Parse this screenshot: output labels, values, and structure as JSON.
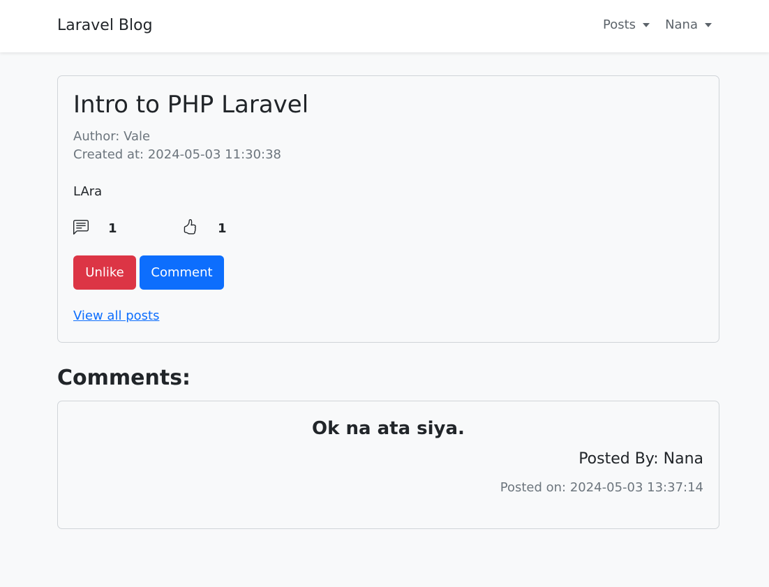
{
  "navbar": {
    "brand": "Laravel Blog",
    "menu": [
      {
        "label": "Posts"
      },
      {
        "label": "Nana"
      }
    ]
  },
  "post": {
    "title": "Intro to PHP Laravel",
    "author": "Author: Vale",
    "created_at": "Created at: 2024-05-03 11:30:38",
    "body": "LAra",
    "comment_count": "1",
    "like_count": "1",
    "unlike_label": "Unlike",
    "comment_label": "Comment",
    "view_all_label": "View all posts"
  },
  "comments": {
    "heading": "Comments:",
    "items": [
      {
        "text": "Ok na ata siya.",
        "posted_by": "Posted By: Nana",
        "posted_on": "Posted on: 2024-05-03 13:37:14"
      }
    ]
  },
  "icons": {
    "comment": "chat-left-text-icon",
    "like": "hand-thumbs-up-icon"
  },
  "colors": {
    "danger": "#dc3545",
    "primary": "#0d6efd",
    "background": "#f8f9fa"
  }
}
